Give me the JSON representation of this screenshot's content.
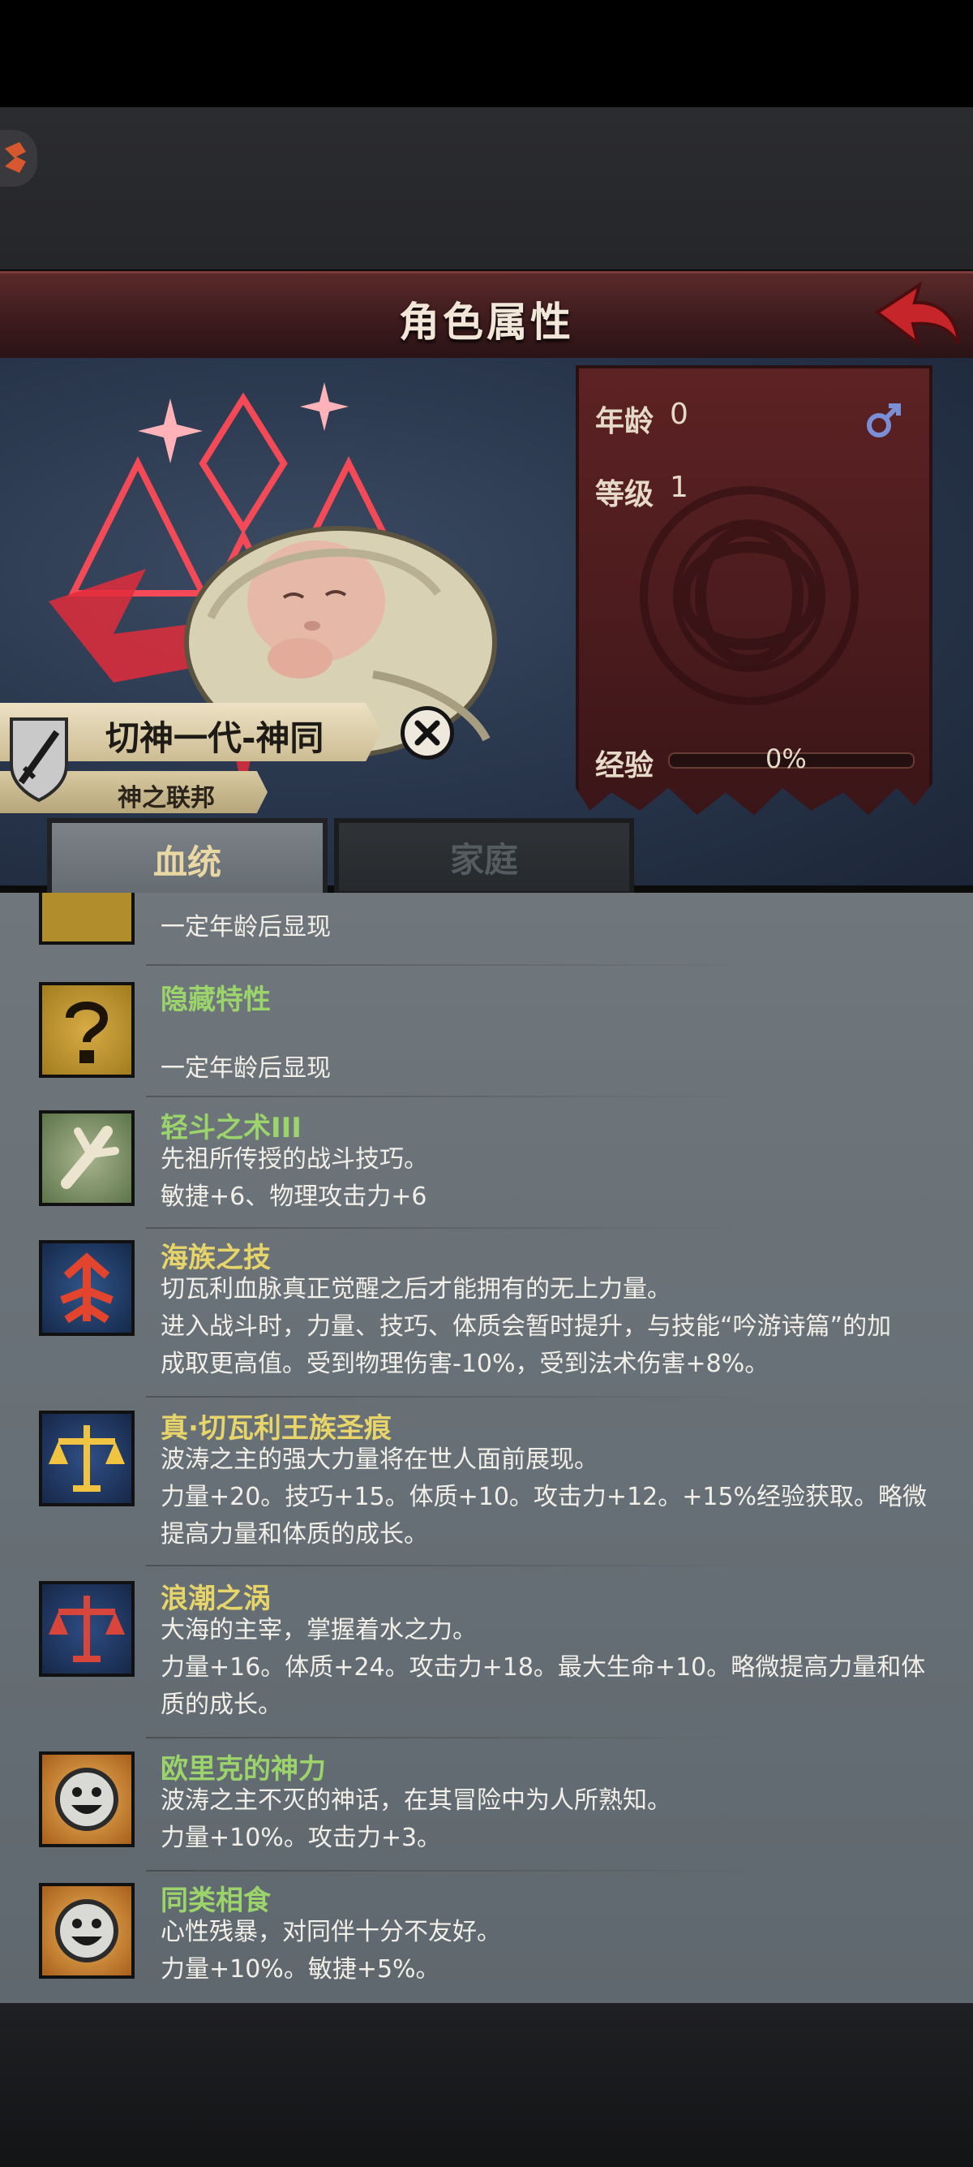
{
  "header": {
    "title": "角色属性"
  },
  "character": {
    "name": "切神一代-神同",
    "faction": "神之联邦",
    "age_label": "年龄",
    "age": "0",
    "level_label": "等级",
    "level": "1",
    "exp_label": "经验",
    "exp_percent": "0%",
    "exp_fraction": 0
  },
  "tabs": [
    {
      "label": "血统",
      "active": true
    },
    {
      "label": "家庭",
      "active": false
    }
  ],
  "traits": [
    {
      "name": "",
      "desc": [
        "一定年龄后显现"
      ],
      "icon": "hidden-trait-icon",
      "color": "green"
    },
    {
      "name": "隐藏特性",
      "desc": [
        "",
        "一定年龄后显现"
      ],
      "icon": "question-mark-icon",
      "color": "green"
    },
    {
      "name": "轻斗之术III",
      "desc": [
        "先祖所传授的战斗技巧。",
        "敏捷+6、物理攻击力+6"
      ],
      "icon": "bone-hand-icon",
      "color": "green"
    },
    {
      "name": "海族之技",
      "desc": [
        "切瓦利血脉真正觉醒之后才能拥有的无上力量。",
        "进入战斗时，力量、技巧、体质会暂时提升，与技能“吟游诗篇”的加",
        "成取更高值。受到物理伤害-10%，受到法术伤害+8%。"
      ],
      "icon": "red-trident-icon",
      "color": "yellow"
    },
    {
      "name": "真·切瓦利王族圣痕",
      "desc": [
        "波涛之主的强大力量将在世人面前展现。",
        "力量+20。技巧+15。体质+10。攻击力+12。+15%经验获取。略微",
        "提高力量和体质的成长。"
      ],
      "icon": "gold-scales-icon",
      "color": "yellow"
    },
    {
      "name": "浪潮之涡",
      "desc": [
        "大海的主宰，掌握着水之力。",
        "力量+16。体质+24。攻击力+18。最大生命+10。略微提高力量和体",
        "质的成长。"
      ],
      "icon": "red-scales-icon",
      "color": "yellow"
    },
    {
      "name": "欧里克的神力",
      "desc": [
        "波涛之主不灭的神话，在其冒险中为人所熟知。",
        "力量+10%。攻击力+3。"
      ],
      "icon": "smiley-face-icon",
      "color": "green"
    },
    {
      "name": "同类相食",
      "desc": [
        "心性残暴，对同伴十分不友好。",
        "力量+10%。敏捷+5%。"
      ],
      "icon": "smiley-face-icon",
      "color": "green"
    }
  ]
}
